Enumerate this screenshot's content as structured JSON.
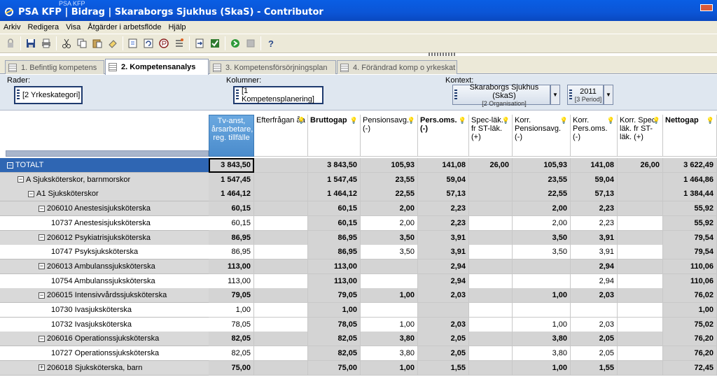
{
  "window": {
    "title": "PSA KFP | Bidrag | Skaraborgs Sjukhus (SkaS) - Contributor",
    "ghost_title": "PSA KFP"
  },
  "menu": [
    "Arkiv",
    "Redigera",
    "Visa",
    "Åtgärder i arbetsflöde",
    "Hjälp"
  ],
  "toolbar_icons": [
    "lock-icon",
    "save-icon",
    "print-icon",
    "cut-icon",
    "copy-icon",
    "paste-icon",
    "fill-icon",
    "import-icon",
    "refresh-icon",
    "annotate-icon",
    "list-icon",
    "goto-icon",
    "check-icon",
    "submit-icon",
    "reject-icon",
    "help-icon"
  ],
  "tabs": [
    {
      "label": "1. Befintlig kompetens",
      "active": false
    },
    {
      "label": "2. Kompetensanalys",
      "active": true
    },
    {
      "label": "3. Kompetensförsörjningsplan",
      "active": false
    },
    {
      "label": "4. Förändrad komp o yrkeskat",
      "active": false
    }
  ],
  "pivot": {
    "rows_label": "Rader:",
    "rows_value": "[2 Yrkeskategori]",
    "cols_label": "Kolumner:",
    "cols_value": "[1 Kompetensplanering]",
    "ctx_label": "Kontext:",
    "ctx1_main": "Skaraborgs Sjukhus (SkaS)",
    "ctx1_sub": "[2 Organisation]",
    "ctx2_main": "2011",
    "ctx2_sub": "[3 Period]"
  },
  "columns": [
    {
      "label": "Tv-anst, årsarbetare, reg. tillfälle",
      "bold": false
    },
    {
      "label": "Efterfrågan åa",
      "bold": false
    },
    {
      "label": "Bruttogap",
      "bold": true
    },
    {
      "label": "Pensionsavg. (-)",
      "bold": false
    },
    {
      "label": "Pers.oms. (-)",
      "bold": true
    },
    {
      "label": "Spec-läk. fr ST-läk. (+)",
      "bold": false
    },
    {
      "label": "Korr. Pensionsavg. (-)",
      "bold": false
    },
    {
      "label": "Korr. Pers.oms. (-)",
      "bold": false
    },
    {
      "label": "Korr. Spec-läk. fr ST-läk. (+)",
      "bold": false
    },
    {
      "label": "Nettogap",
      "bold": true
    }
  ],
  "rows": [
    {
      "label": "TOTALT",
      "indent": 0,
      "pm": "−",
      "type": "total",
      "values": [
        "3 843,50",
        "",
        "3 843,50",
        "105,93",
        "141,08",
        "26,00",
        "105,93",
        "141,08",
        "26,00",
        "3 622,49"
      ]
    },
    {
      "label": "A Sjuksköterskor, barnmorskor",
      "indent": 1,
      "pm": "−",
      "type": "group",
      "values": [
        "1 547,45",
        "",
        "1 547,45",
        "23,55",
        "59,04",
        "",
        "23,55",
        "59,04",
        "",
        "1 464,86"
      ]
    },
    {
      "label": "A1 Sjuksköterskor",
      "indent": 2,
      "pm": "−",
      "type": "group",
      "values": [
        "1 464,12",
        "",
        "1 464,12",
        "22,55",
        "57,13",
        "",
        "22,55",
        "57,13",
        "",
        "1 384,44"
      ]
    },
    {
      "label": "206010 Anestesisjuksköterska",
      "indent": 3,
      "pm": "−",
      "type": "group",
      "values": [
        "60,15",
        "",
        "60,15",
        "2,00",
        "2,23",
        "",
        "2,00",
        "2,23",
        "",
        "55,92"
      ]
    },
    {
      "label": "10737 Anestesisjuksköterska",
      "indent": 4,
      "pm": "",
      "type": "leaf",
      "values": [
        "60,15",
        "",
        "60,15",
        "2,00",
        "2,23",
        "",
        "2,00",
        "2,23",
        "",
        "55,92"
      ]
    },
    {
      "label": "206012 Psykiatrisjuksköterska",
      "indent": 3,
      "pm": "−",
      "type": "group",
      "values": [
        "86,95",
        "",
        "86,95",
        "3,50",
        "3,91",
        "",
        "3,50",
        "3,91",
        "",
        "79,54"
      ]
    },
    {
      "label": "10747 Psyksjuksköterska",
      "indent": 4,
      "pm": "",
      "type": "leaf",
      "values": [
        "86,95",
        "",
        "86,95",
        "3,50",
        "3,91",
        "",
        "3,50",
        "3,91",
        "",
        "79,54"
      ]
    },
    {
      "label": "206013 Ambulanssjuksköterska",
      "indent": 3,
      "pm": "−",
      "type": "group",
      "values": [
        "113,00",
        "",
        "113,00",
        "",
        "2,94",
        "",
        "",
        "2,94",
        "",
        "110,06"
      ]
    },
    {
      "label": "10754 Ambulanssjuksköterska",
      "indent": 4,
      "pm": "",
      "type": "leaf",
      "values": [
        "113,00",
        "",
        "113,00",
        "",
        "2,94",
        "",
        "",
        "2,94",
        "",
        "110,06"
      ]
    },
    {
      "label": "206015 Intensivvårdssjuksköterska",
      "indent": 3,
      "pm": "−",
      "type": "group",
      "values": [
        "79,05",
        "",
        "79,05",
        "1,00",
        "2,03",
        "",
        "1,00",
        "2,03",
        "",
        "76,02"
      ]
    },
    {
      "label": "10730 Ivasjuksköterska",
      "indent": 4,
      "pm": "",
      "type": "leaf",
      "values": [
        "1,00",
        "",
        "1,00",
        "",
        "",
        "",
        "",
        "",
        "",
        "1,00"
      ]
    },
    {
      "label": "10732 Ivasjuksköterska",
      "indent": 4,
      "pm": "",
      "type": "leaf",
      "values": [
        "78,05",
        "",
        "78,05",
        "1,00",
        "2,03",
        "",
        "1,00",
        "2,03",
        "",
        "75,02"
      ]
    },
    {
      "label": "206016 Operationssjuksköterska",
      "indent": 3,
      "pm": "−",
      "type": "group",
      "values": [
        "82,05",
        "",
        "82,05",
        "3,80",
        "2,05",
        "",
        "3,80",
        "2,05",
        "",
        "76,20"
      ]
    },
    {
      "label": "10727 Operationssjuksköterska",
      "indent": 4,
      "pm": "",
      "type": "leaf",
      "values": [
        "82,05",
        "",
        "82,05",
        "3,80",
        "2,05",
        "",
        "3,80",
        "2,05",
        "",
        "76,20"
      ]
    },
    {
      "label": "206018 Sjuksköterska, barn",
      "indent": 3,
      "pm": "+",
      "type": "group",
      "values": [
        "75,00",
        "",
        "75,00",
        "1,00",
        "1,55",
        "",
        "1,00",
        "1,55",
        "",
        "72,45"
      ]
    }
  ]
}
